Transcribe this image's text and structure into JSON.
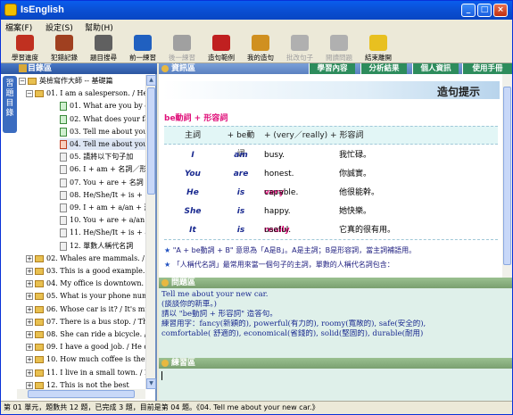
{
  "app": {
    "title": "IsEnglish"
  },
  "menu": [
    "檔案(F)",
    "設定(S)",
    "幫助(H)"
  ],
  "toolbar": [
    {
      "label": "學習進度",
      "icon": "progress-icon",
      "color": "#c03020",
      "disabled": false
    },
    {
      "label": "犯錯記錄",
      "icon": "error-log-icon",
      "color": "#a04020",
      "disabled": false
    },
    {
      "label": "題目搜尋",
      "icon": "search-icon",
      "color": "#606060",
      "disabled": false
    },
    {
      "label": "前一練習",
      "icon": "prev-icon",
      "color": "#2060c0",
      "disabled": false
    },
    {
      "label": "後一練習",
      "icon": "next-icon",
      "color": "#a0a0a0",
      "disabled": true
    },
    {
      "label": "造句範例",
      "icon": "example-book-icon",
      "color": "#c02020",
      "disabled": false
    },
    {
      "label": "我的造句",
      "icon": "my-sentence-icon",
      "color": "#d09020",
      "disabled": false
    },
    {
      "label": "批改句子",
      "icon": "correct-icon",
      "color": "#b0b0b0",
      "disabled": true
    },
    {
      "label": "閱讀問題",
      "icon": "read-icon",
      "color": "#b0b0b0",
      "disabled": true
    },
    {
      "label": "結束離開",
      "icon": "exit-icon",
      "color": "#e8c020",
      "disabled": false
    }
  ],
  "sidebar": {
    "header": "目錄區",
    "vtab": "習題目錄",
    "tree": [
      {
        "level": 0,
        "kind": "folder",
        "expander": "−",
        "text": "英檢寫作大師 -- 基礎篇"
      },
      {
        "level": 1,
        "kind": "folder",
        "expander": "−",
        "text": "01. I am a salesperson. / He i"
      },
      {
        "level": 2,
        "kind": "done",
        "text": "01. What are you by c"
      },
      {
        "level": 2,
        "kind": "done",
        "text": "02. What does your fa"
      },
      {
        "level": 2,
        "kind": "done",
        "text": "03. Tell me about you"
      },
      {
        "level": 2,
        "kind": "cur",
        "text": "04. Tell me about you",
        "selected": true
      },
      {
        "level": 2,
        "kind": "doc",
        "text": "05. 請將以下句子加"
      },
      {
        "level": 2,
        "kind": "doc",
        "text": "06. I + am + 名詞／形"
      },
      {
        "level": 2,
        "kind": "doc",
        "text": "07. You + are + 名詞"
      },
      {
        "level": 2,
        "kind": "doc",
        "text": "08. He/She/It + is + 名"
      },
      {
        "level": 2,
        "kind": "doc",
        "text": "09. I + am + a/an + 形"
      },
      {
        "level": 2,
        "kind": "doc",
        "text": "10. You + are + a/an +"
      },
      {
        "level": 2,
        "kind": "doc",
        "text": "11. He/She/It + is + a"
      },
      {
        "level": 2,
        "kind": "doc",
        "text": "12. 單數人稱代名詞"
      },
      {
        "level": 1,
        "kind": "folder",
        "expander": "+",
        "text": "02. Whales are mammals. / I"
      },
      {
        "level": 1,
        "kind": "folder",
        "expander": "+",
        "text": "03. This is a good example. /"
      },
      {
        "level": 1,
        "kind": "folder",
        "expander": "+",
        "text": "04. My office is downtown."
      },
      {
        "level": 1,
        "kind": "folder",
        "expander": "+",
        "text": "05. What is your phone num"
      },
      {
        "level": 1,
        "kind": "folder",
        "expander": "+",
        "text": "06. Whose car is it? / It's mi"
      },
      {
        "level": 1,
        "kind": "folder",
        "expander": "+",
        "text": "07. There is a bus stop. / The"
      },
      {
        "level": 1,
        "kind": "folder",
        "expander": "+",
        "text": "08. She can ride a bicycle. /"
      },
      {
        "level": 1,
        "kind": "folder",
        "expander": "+",
        "text": "09. I have a good job. / He d"
      },
      {
        "level": 1,
        "kind": "folder",
        "expander": "+",
        "text": "10. How much coffee is ther"
      },
      {
        "level": 1,
        "kind": "folder",
        "expander": "+",
        "text": "11. I live in a small town. / I"
      },
      {
        "level": 1,
        "kind": "folder",
        "expander": "+",
        "text": "12. This is not the best"
      }
    ]
  },
  "info": {
    "header": "資訊區",
    "tabs": [
      {
        "label": "學習內容",
        "active": true
      },
      {
        "label": "分析結果",
        "active": false
      },
      {
        "label": "個人資訊",
        "active": false
      },
      {
        "label": "使用手冊",
        "active": false
      }
    ],
    "title": "造句提示",
    "rule": "be動詞 + 形容詞",
    "table_head": [
      "主詞",
      "+ be動詞",
      "+ (very／really) + 形容詞"
    ],
    "rows": [
      {
        "subj": "I",
        "be": "am",
        "pre": "",
        "adj": "busy.",
        "zh": "我忙碌。"
      },
      {
        "subj": "You",
        "be": "are",
        "pre": "",
        "adj": "honest.",
        "zh": "你誠實。"
      },
      {
        "subj": "He",
        "be": "is",
        "pre": "very",
        "adj": "capable.",
        "zh": "他很能幹。"
      },
      {
        "subj": "She",
        "be": "is",
        "pre": "",
        "adj": "happy.",
        "zh": "她快樂。"
      },
      {
        "subj": "It",
        "be": "is",
        "pre": "really",
        "adj": "useful.",
        "zh": "它真的很有用。"
      }
    ],
    "notes": [
      "\"A + be動詞 + B\" 意思為「A是B」。A是主詞；B是形容詞，當主詞補語用。",
      "「人稱代名詞」最常用來當一個句子的主詞，單數的人稱代名詞包含："
    ]
  },
  "question": {
    "header": "問題區",
    "lines": [
      "Tell me about your new car.",
      "(談談你的新車。)",
      "請以 \"be動詞 + 形容詞\" 造答句。",
      "練習用字：fancy(新穎的), powerful(有力的), roomy(寬敞的), safe(安全的),",
      "comfortable( 舒適的), economical(省錢的), solid(堅固的), durable(耐用)"
    ]
  },
  "practice": {
    "header": "練習區",
    "value": ""
  },
  "status": "第 01 單元，題數共 12 題，已完成 3 題，目前是第 04 題。《04. Tell me about your new car.》"
}
